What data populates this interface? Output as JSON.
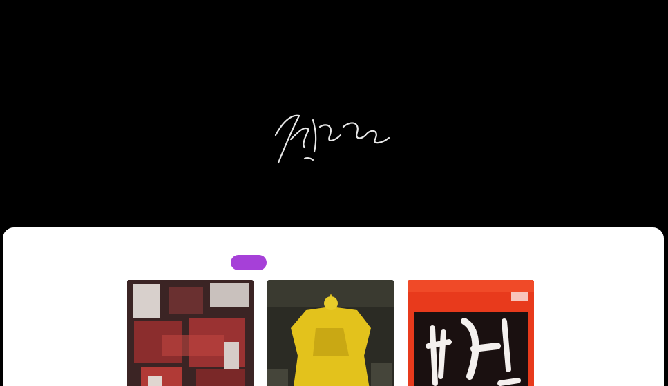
{
  "nav": {
    "brand": "",
    "links": [
      "",
      "",
      "",
      ""
    ]
  },
  "hero": {
    "logo_icon": "signature-logo-icon"
  },
  "tabs": {
    "items": [
      "",
      "",
      "",
      "",
      ""
    ],
    "active_index": 0,
    "active_color": "#a640d8"
  },
  "covers": [
    {
      "name": "album-cover-1",
      "dominant_color": "#8a2a2a"
    },
    {
      "name": "album-cover-2",
      "dominant_color": "#e2c41a"
    },
    {
      "name": "album-cover-3",
      "dominant_color": "#e83a1c"
    }
  ],
  "colors": {
    "background": "#000000",
    "panel": "#ffffff",
    "accent": "#a640d8"
  }
}
